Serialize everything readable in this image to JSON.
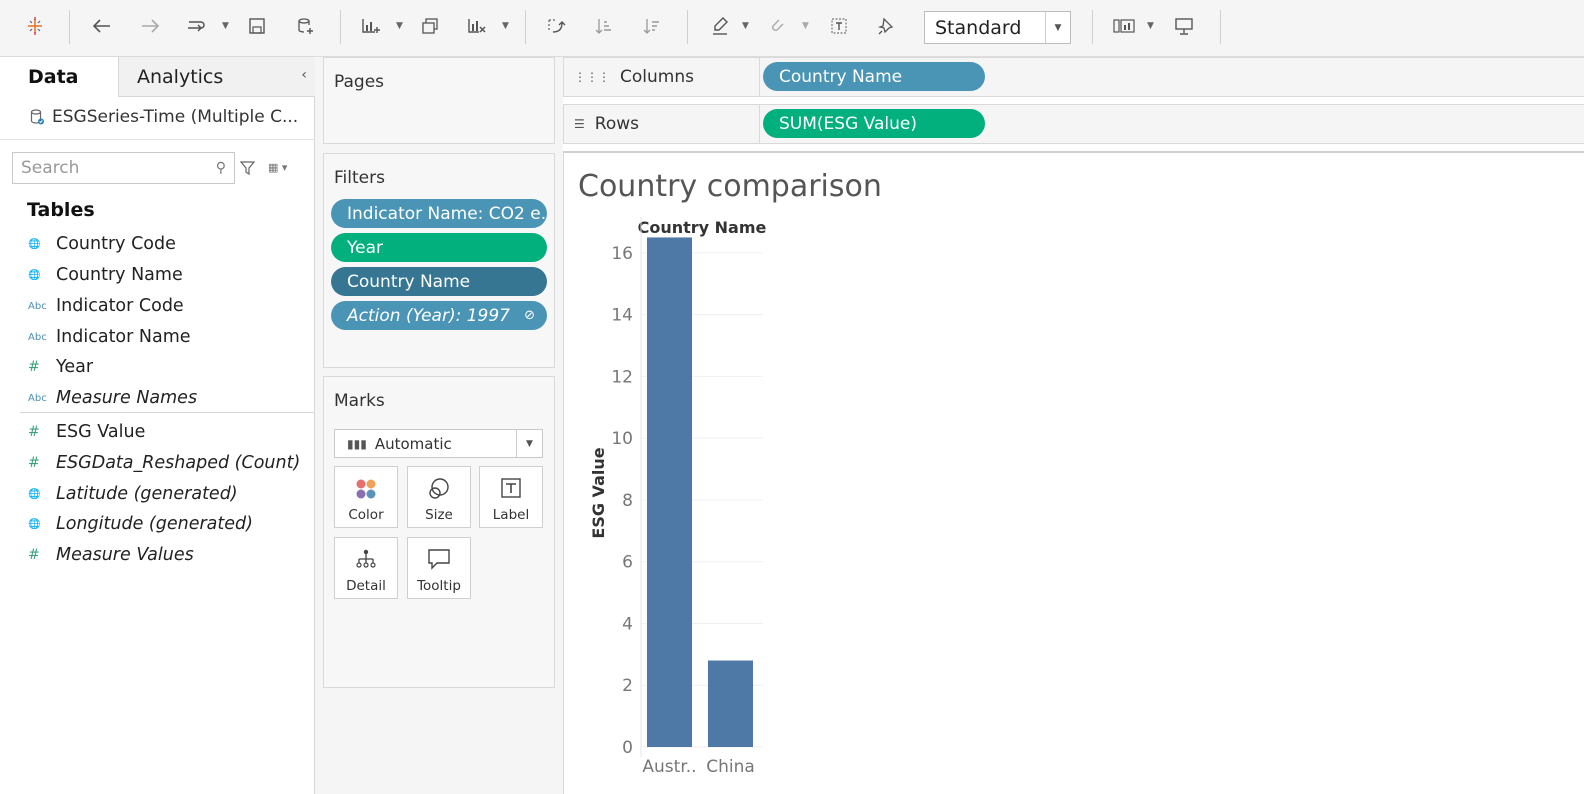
{
  "toolbar": {
    "view_mode": "Standard"
  },
  "left_pane": {
    "tabs": {
      "data": "Data",
      "analytics": "Analytics"
    },
    "datasource": "ESGSeries-Time (Multiple C...",
    "search_placeholder": "Search",
    "tables_header": "Tables",
    "fields": [
      {
        "name": "Country Code",
        "type": "geo"
      },
      {
        "name": "Country Name",
        "type": "geo"
      },
      {
        "name": "Indicator Code",
        "type": "string"
      },
      {
        "name": "Indicator Name",
        "type": "string"
      },
      {
        "name": "Year",
        "type": "number"
      },
      {
        "name": "Measure Names",
        "type": "string",
        "italic": true
      }
    ],
    "measures": [
      {
        "name": "ESG Value",
        "type": "number"
      },
      {
        "name": "ESGData_Reshaped (Count)",
        "type": "number",
        "italic": true
      },
      {
        "name": "Latitude (generated)",
        "type": "geo",
        "italic": true
      },
      {
        "name": "Longitude (generated)",
        "type": "geo",
        "italic": true
      },
      {
        "name": "Measure Values",
        "type": "number",
        "italic": true
      }
    ]
  },
  "pages": {
    "title": "Pages"
  },
  "filters": {
    "title": "Filters",
    "items": [
      "Indicator Name: CO2 e..",
      "Year",
      "Country Name",
      "Action (Year): 1997"
    ]
  },
  "marks": {
    "title": "Marks",
    "type": "Automatic",
    "buttons": [
      "Color",
      "Size",
      "Label",
      "Detail",
      "Tooltip"
    ]
  },
  "shelves": {
    "columns_label": "Columns",
    "columns_pill": "Country Name",
    "rows_label": "Rows",
    "rows_pill": "SUM(ESG Value)"
  },
  "colors": {
    "dimension_pill": "#4a95b6",
    "measure_pill": "#02b07e",
    "bar": "#4e79a7"
  },
  "chart_data": {
    "type": "bar",
    "title": "Country comparison",
    "column_header": "Country Name",
    "ylabel": "ESG Value",
    "categories": [
      "Austr..",
      "China"
    ],
    "values": [
      16.5,
      2.8
    ],
    "ylim": [
      0,
      17
    ],
    "yticks": [
      0,
      2,
      4,
      6,
      8,
      10,
      12,
      14,
      16
    ],
    "grid": true
  }
}
